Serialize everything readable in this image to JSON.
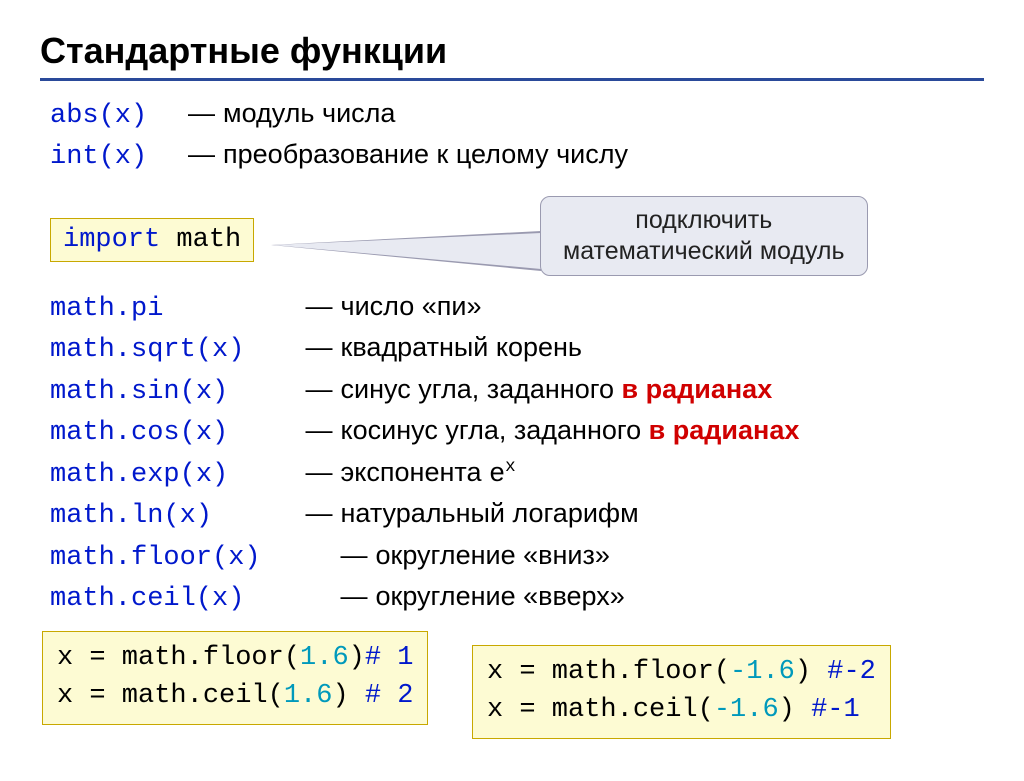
{
  "title": "Стандартные функции",
  "builtin": [
    {
      "code": "abs(x)",
      "desc": "модуль числа"
    },
    {
      "code": "int(x)",
      "desc": "преобразование к целому числу"
    }
  ],
  "import_stmt": {
    "kw": "import",
    "mod": "math"
  },
  "callout": {
    "line1": "подключить",
    "line2": "математический модуль"
  },
  "mathfuncs": [
    {
      "code": "math.pi",
      "desc_pre": "число «пи»",
      "desc_red": ""
    },
    {
      "code": "math.sqrt(x)",
      "desc_pre": "квадратный корень",
      "desc_red": ""
    },
    {
      "code": "math.sin(x)",
      "desc_pre": "синус угла, заданного ",
      "desc_red": "в радианах"
    },
    {
      "code": "math.cos(x)",
      "desc_pre": "косинус угла, заданного ",
      "desc_red": "в радианах"
    },
    {
      "code": "math.exp(x)",
      "desc_pre": "экспонента ",
      "desc_red": "",
      "exp": true
    },
    {
      "code": "math.ln(x)",
      "desc_pre": "натуральный логарифм",
      "desc_red": ""
    },
    {
      "code": "math.floor(x)",
      "desc_pre": "округление «вниз»",
      "desc_red": "",
      "wide": true
    },
    {
      "code": "math.ceil(x)",
      "desc_pre": "округление «вверх»",
      "desc_red": "",
      "wide": true
    }
  ],
  "ex1": {
    "l1_a": "x = math.floor(",
    "l1_b": "1.6",
    "l1_c": ")",
    "l1_comment": "# 1",
    "l2_a": "x = math.ceil(",
    "l2_b": "1.6",
    "l2_c": ") ",
    "l2_comment": "# 2"
  },
  "ex2": {
    "l1_a": "x = math.floor(",
    "l1_b": "-1.6",
    "l1_c": ") ",
    "l1_comment": "#-2",
    "l2_a": "x = math.ceil(",
    "l2_b": "-1.6",
    "l2_c": ")  ",
    "l2_comment": "#-1"
  },
  "exp_base": "e",
  "exp_sup": "x"
}
